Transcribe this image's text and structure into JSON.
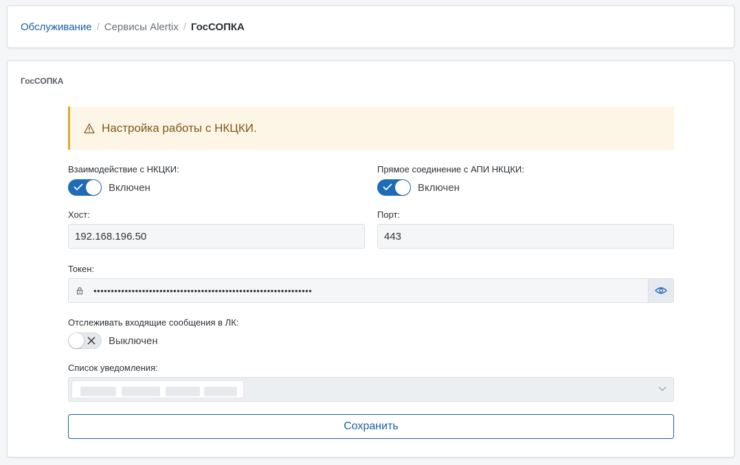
{
  "breadcrumb": {
    "items": [
      "Обслуживание",
      "Сервисы Alertix",
      "ГосСОПКА"
    ],
    "separator": "/"
  },
  "section": {
    "title": "ГосСОПКА"
  },
  "alert": {
    "text": "Настройка работы с НКЦКИ.",
    "icon": "warning-icon"
  },
  "form": {
    "nkcki_interaction": {
      "label": "Взаимодействие с НКЦКИ:",
      "state": "Включен",
      "enabled": true
    },
    "direct_api": {
      "label": "Прямое соединение с АПИ НКЦКИ:",
      "state": "Включен",
      "enabled": true
    },
    "host": {
      "label": "Хост:",
      "value": "192.168.196.50"
    },
    "port": {
      "label": "Порт:",
      "value": "443"
    },
    "token": {
      "label": "Токен:",
      "masked_value": "•••••••••••••••••••••••••••••••••••••••••••••••••••••••••••••••"
    },
    "track_incoming": {
      "label": "Отслеживать входящие сообщения в ЛК:",
      "state": "Выключен",
      "enabled": false
    },
    "notification_list": {
      "label": "Список уведомления:"
    },
    "save_label": "Сохранить"
  },
  "colors": {
    "accent": "#1e6bb8",
    "link": "#1a5fa0",
    "alert_bg": "#fdf5e6",
    "alert_border": "#e3a826",
    "alert_text": "#7a5a17"
  }
}
